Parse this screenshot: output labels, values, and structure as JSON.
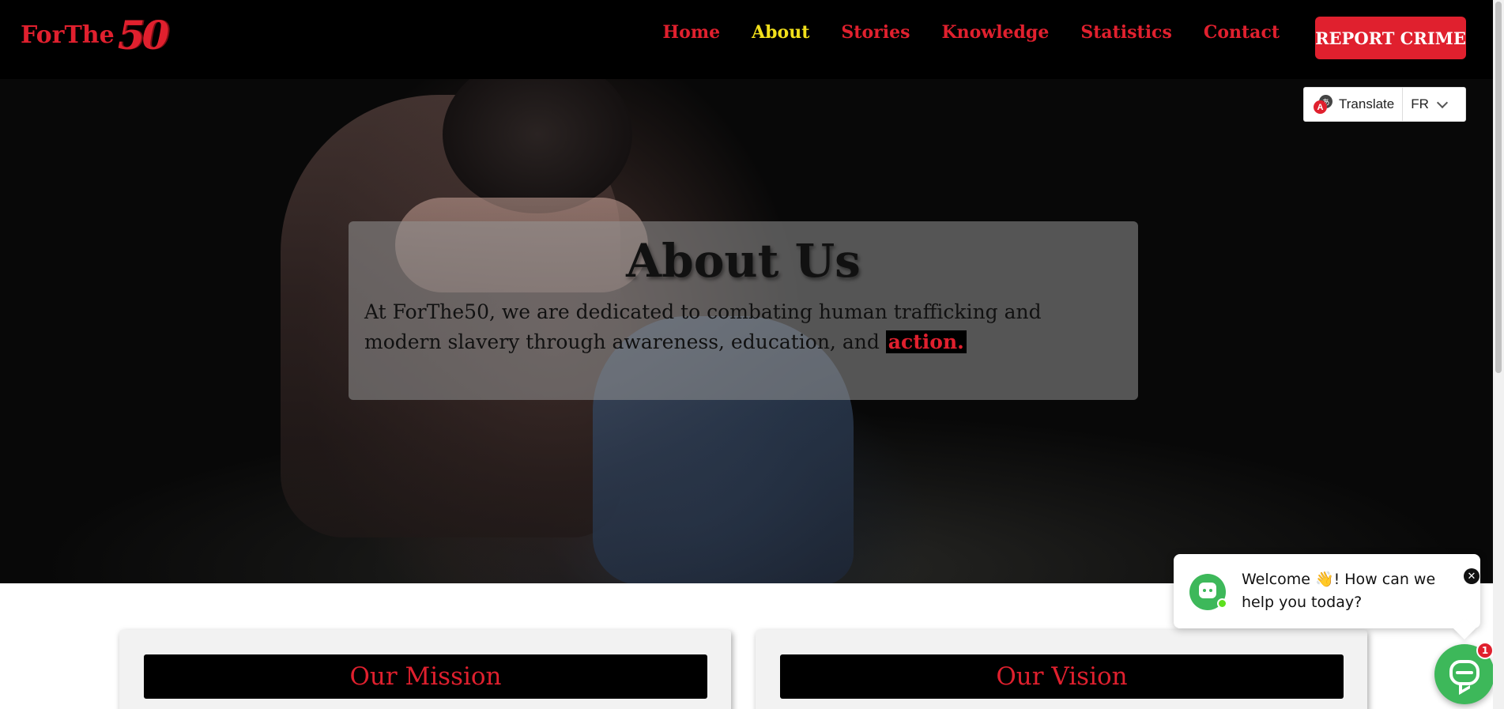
{
  "brand": {
    "logo_text": "ForThe",
    "logo_number": "50",
    "color_primary": "#e0202e",
    "color_active": "#f2e01b"
  },
  "nav": {
    "items": [
      {
        "label": "Home"
      },
      {
        "label": "About"
      },
      {
        "label": "Stories"
      },
      {
        "label": "Knowledge"
      },
      {
        "label": "Statistics"
      },
      {
        "label": "Contact"
      }
    ],
    "active": "About",
    "report_button": "REPORT CRIME"
  },
  "translate": {
    "label": "Translate",
    "language": "FR",
    "icon": "translate-icon"
  },
  "hero": {
    "title": "About Us",
    "text_before": "At ForThe50, we are dedicated to combating human trafficking and modern slavery through awareness, education, and",
    "text_highlight": "action."
  },
  "cards": {
    "mission_title": "Our Mission",
    "vision_title": "Our Vision"
  },
  "chat": {
    "message": "Welcome 👋! How can we help you today?",
    "badge_count": "1",
    "close_symbol": "✕"
  }
}
